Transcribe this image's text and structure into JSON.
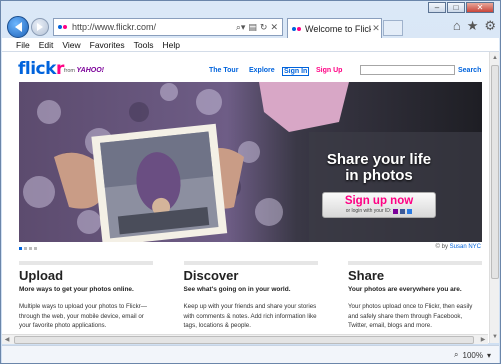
{
  "browser": {
    "address_url": "http://www.flickr.com/",
    "tab_title": "Welcome to Flickr - ...",
    "menu": [
      "File",
      "Edit",
      "View",
      "Favorites",
      "Tools",
      "Help"
    ],
    "zoom": "100%"
  },
  "header": {
    "logo_blue": "flick",
    "logo_pink": "r",
    "logo_from": "from",
    "logo_yahoo": "YAHOO!",
    "nav": {
      "tour": "The Tour",
      "explore": "Explore",
      "signin": "Sign In",
      "signup": "Sign Up"
    },
    "search_label": "Search"
  },
  "hero": {
    "title_line1": "Share your life",
    "title_line2": "in photos",
    "signup_label": "Sign up now",
    "login_text": "or login with your ID:",
    "credit_prefix": "© by",
    "credit_name": "Susan NYC"
  },
  "columns": [
    {
      "title": "Upload",
      "subtitle": "More ways to get your photos online.",
      "body": "Multiple ways to upload your photos to Flickr— through the web, your mobile device, email or your favorite photo applications."
    },
    {
      "title": "Discover",
      "subtitle": "See what's going on in your world.",
      "body": "Keep up with your friends and share your stories with comments & notes. Add rich information like tags, locations & people."
    },
    {
      "title": "Share",
      "subtitle": "Your photos are everywhere you are.",
      "body": "Your photos upload once to Flickr, then easily and safely share them through Facebook, Twitter, email, blogs and more."
    }
  ],
  "colors": {
    "flickr_blue": "#0063dc",
    "flickr_pink": "#ff0084"
  }
}
